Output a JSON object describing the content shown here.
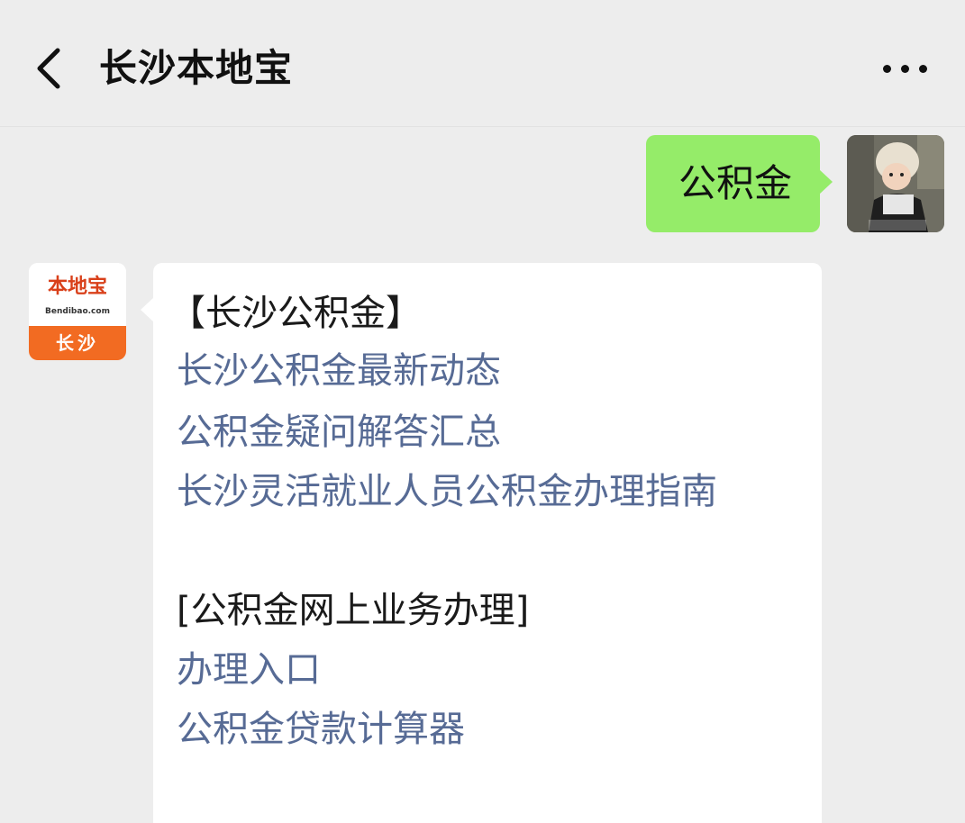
{
  "header": {
    "title": "长沙本地宝"
  },
  "outgoing_message": {
    "text": "公积金"
  },
  "bot_avatar": {
    "logo_text": "本地宝",
    "logo_url": "Bendibao.com",
    "city": "长沙"
  },
  "incoming_message": {
    "section1_heading": "【长沙公积金】",
    "section1_links": [
      "长沙公积金最新动态",
      "公积金疑问解答汇总",
      "长沙灵活就业人员公积金办理指南"
    ],
    "section2_heading": "[公积金网上业务办理]",
    "section2_links": [
      "办理入口",
      "公积金贷款计算器"
    ]
  },
  "colors": {
    "background": "#ededed",
    "outgoing_bubble": "#95ec69",
    "incoming_bubble": "#ffffff",
    "link": "#576b95",
    "logo_orange": "#f26b22",
    "logo_red": "#d9401a"
  },
  "icons": {
    "back": "chevron-left-icon",
    "more": "more-dots-icon"
  }
}
